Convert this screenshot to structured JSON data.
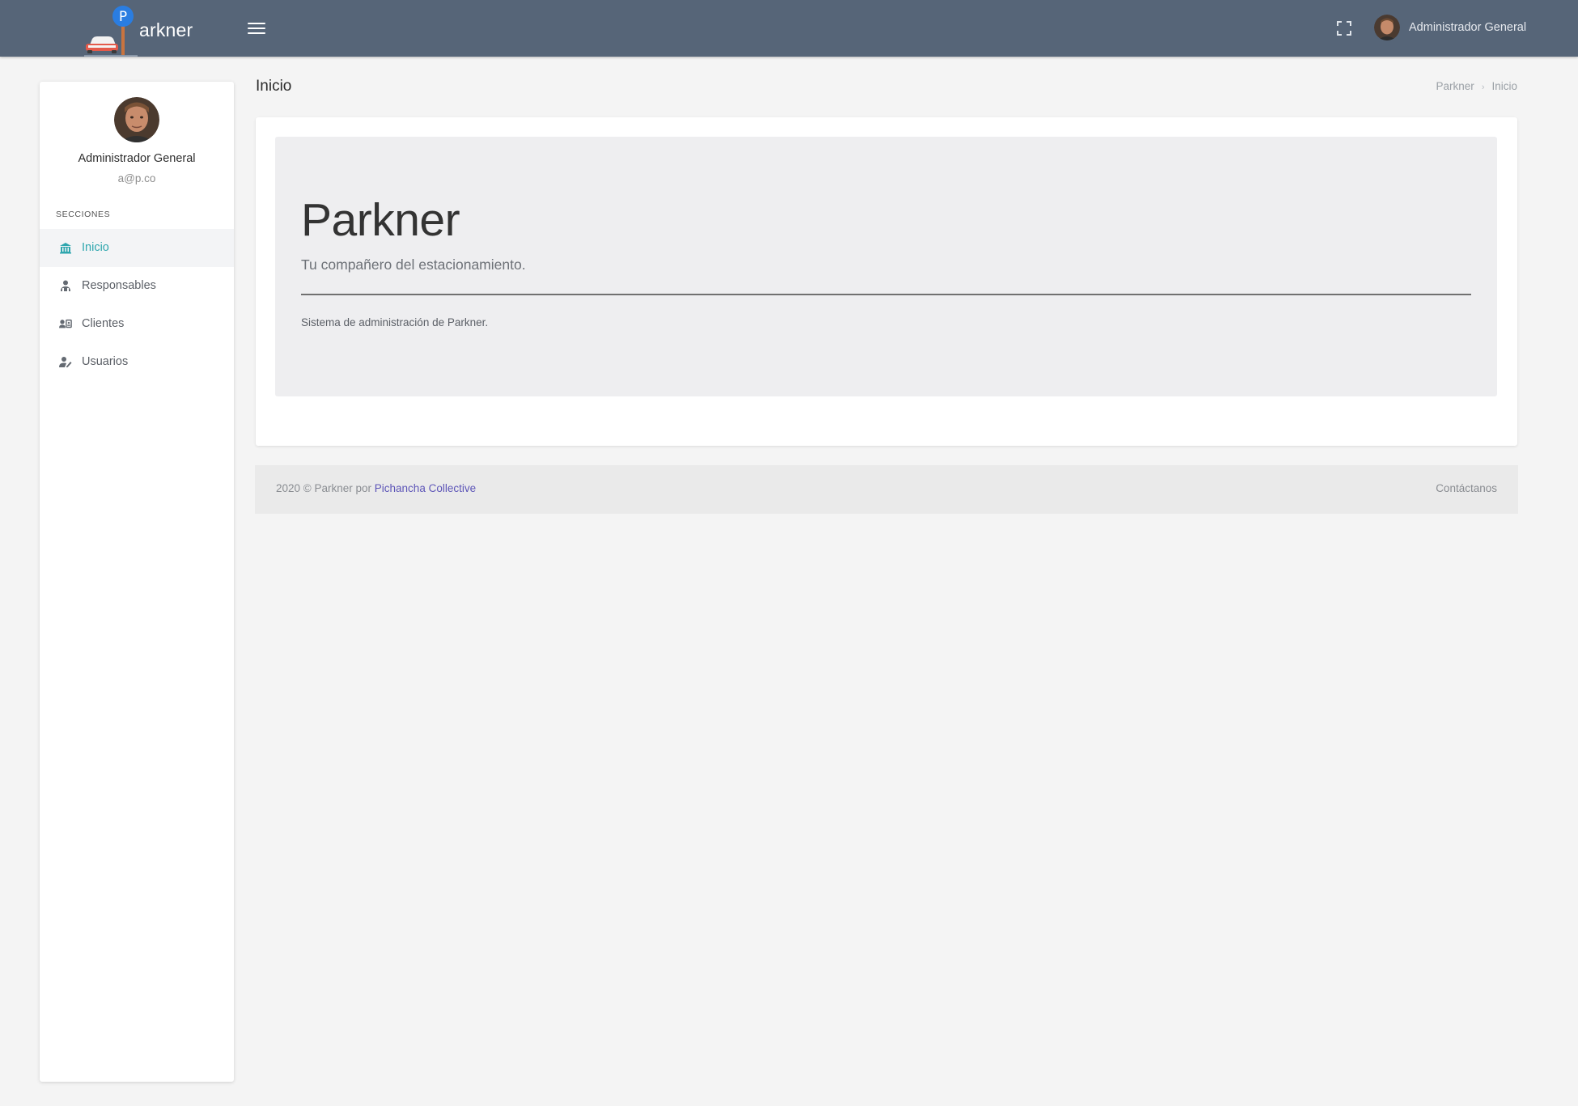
{
  "app": {
    "brand_name": "arkner",
    "logo_letter": "P"
  },
  "topbar": {
    "user_name": "Administrador General"
  },
  "sidebar": {
    "profile": {
      "name": "Administrador General",
      "email": "a@p.co"
    },
    "section_title": "SECCIONES",
    "items": [
      {
        "label": "Inicio",
        "icon": "bank-icon",
        "active": true
      },
      {
        "label": "Responsables",
        "icon": "people-icon",
        "active": false
      },
      {
        "label": "Clientes",
        "icon": "contacts-icon",
        "active": false
      },
      {
        "label": "Usuarios",
        "icon": "user-edit-icon",
        "active": false
      }
    ]
  },
  "page": {
    "title": "Inicio",
    "breadcrumb": [
      "Parkner",
      "Inicio"
    ]
  },
  "jumbotron": {
    "title": "Parkner",
    "lead": "Tu compañero del estacionamiento.",
    "text": "Sistema de administración de Parkner."
  },
  "footer": {
    "copyright": "2020 © Parkner por",
    "author_link": "Pichancha Collective",
    "contact": "Contáctanos"
  },
  "colors": {
    "topbar": "#566578",
    "accent": "#2ea6ae",
    "link": "#5e56b8",
    "logo_blue": "#2a7de1"
  }
}
